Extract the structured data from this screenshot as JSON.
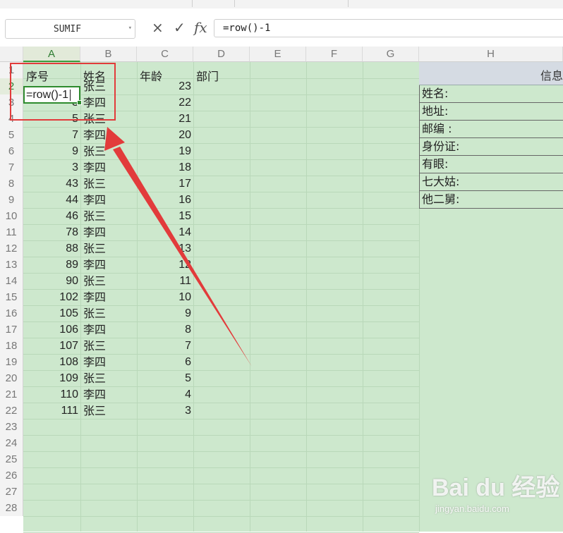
{
  "formula_bar": {
    "name_box": "SUMIF",
    "cancel_icon": "×",
    "confirm_icon": "✓",
    "fx_label": "fx",
    "formula": "=row()-1"
  },
  "columns": [
    "A",
    "B",
    "C",
    "D",
    "E",
    "F",
    "G",
    "H"
  ],
  "active_column": "A",
  "active_row": 2,
  "row_numbers": [
    "1",
    "2",
    "3",
    "4",
    "5",
    "6",
    "7",
    "8",
    "9",
    "10",
    "11",
    "12",
    "13",
    "14",
    "15",
    "16",
    "17",
    "18",
    "19",
    "20",
    "21",
    "22",
    "23",
    "24",
    "25",
    "26",
    "27",
    "28"
  ],
  "headers": {
    "a": "序号",
    "b": "姓名",
    "c": "年龄",
    "d": "部门"
  },
  "active_cell_text": "=row()-1",
  "rows": [
    {
      "a": "",
      "b": "张三",
      "c": "23"
    },
    {
      "a": "3",
      "b": "李四",
      "c": "22"
    },
    {
      "a": "5",
      "b": "张三",
      "c": "21"
    },
    {
      "a": "7",
      "b": "李四",
      "c": "20"
    },
    {
      "a": "9",
      "b": "张三",
      "c": "19"
    },
    {
      "a": "3",
      "b": "李四",
      "c": "18"
    },
    {
      "a": "43",
      "b": "张三",
      "c": "17"
    },
    {
      "a": "44",
      "b": "李四",
      "c": "16"
    },
    {
      "a": "46",
      "b": "张三",
      "c": "15"
    },
    {
      "a": "78",
      "b": "李四",
      "c": "14"
    },
    {
      "a": "88",
      "b": "张三",
      "c": "13"
    },
    {
      "a": "89",
      "b": "李四",
      "c": "12"
    },
    {
      "a": "90",
      "b": "张三",
      "c": "11"
    },
    {
      "a": "102",
      "b": "李四",
      "c": "10"
    },
    {
      "a": "105",
      "b": "张三",
      "c": "9"
    },
    {
      "a": "106",
      "b": "李四",
      "c": "8"
    },
    {
      "a": "107",
      "b": "张三",
      "c": "7"
    },
    {
      "a": "108",
      "b": "李四",
      "c": "6"
    },
    {
      "a": "109",
      "b": "张三",
      "c": "5"
    },
    {
      "a": "110",
      "b": "李四",
      "c": "4"
    },
    {
      "a": "111",
      "b": "张三",
      "c": "3"
    }
  ],
  "info_panel": {
    "title": "信息",
    "fields": [
      "姓名:",
      "地址:",
      "邮编 :",
      "身份证:",
      "有眼:",
      "七大姑:",
      "他二舅:"
    ]
  },
  "watermark": {
    "brand": "Bai du 经验",
    "url": "jingyan.baidu.com"
  },
  "colors": {
    "sheet_bg": "#cde8cd",
    "active_border": "#2e8b2e",
    "annotation": "#e23b3b",
    "panel_header": "#d5dbe3"
  }
}
